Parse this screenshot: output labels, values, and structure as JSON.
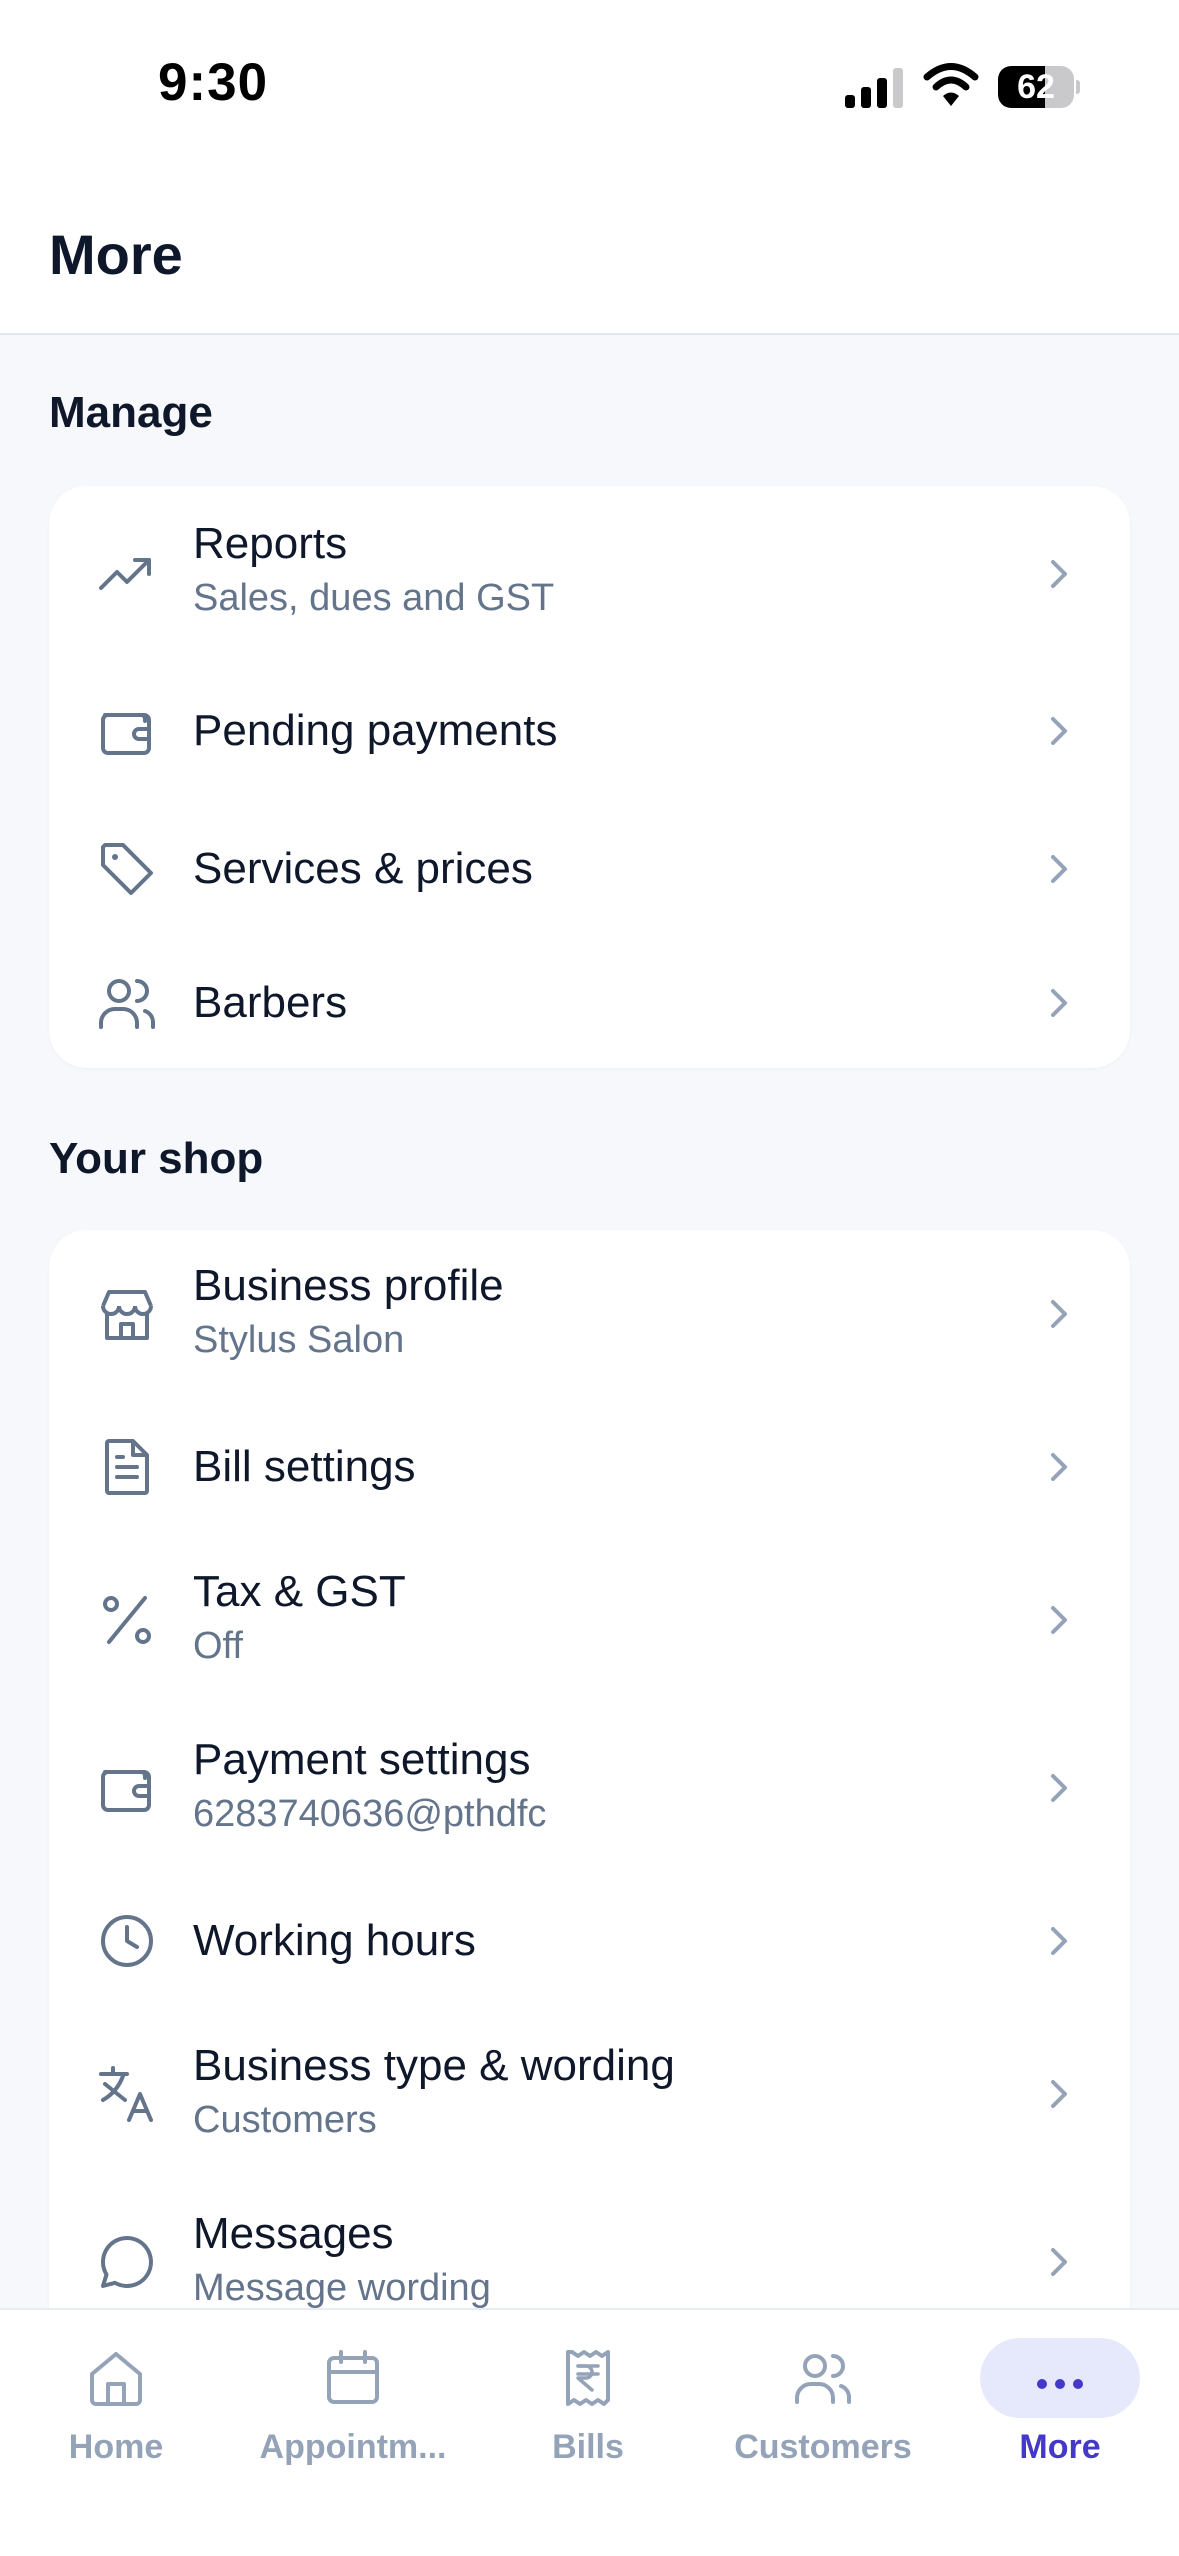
{
  "status_bar": {
    "time": "9:30",
    "battery_level": "62"
  },
  "header": {
    "title": "More"
  },
  "manage": {
    "title": "Manage",
    "items": [
      {
        "label": "Reports",
        "sub": "Sales, dues and GST",
        "icon": "trending-up-icon"
      },
      {
        "label": "Pending payments",
        "sub": "",
        "icon": "wallet-icon"
      },
      {
        "label": "Services & prices",
        "sub": "",
        "icon": "tag-icon"
      },
      {
        "label": "Barbers",
        "sub": "",
        "icon": "users-icon"
      }
    ]
  },
  "shop": {
    "title": "Your shop",
    "items": [
      {
        "label": "Business profile",
        "sub": "Stylus Salon",
        "icon": "store-icon"
      },
      {
        "label": "Bill settings",
        "sub": "",
        "icon": "document-icon"
      },
      {
        "label": "Tax & GST",
        "sub": "Off",
        "icon": "percent-icon"
      },
      {
        "label": "Payment settings",
        "sub": "6283740636@pthdfc",
        "icon": "wallet-icon"
      },
      {
        "label": "Working hours",
        "sub": "",
        "icon": "clock-icon"
      },
      {
        "label": "Business type & wording",
        "sub": "Customers",
        "icon": "translate-icon"
      },
      {
        "label": "Messages",
        "sub": "Message wording",
        "icon": "chat-icon"
      }
    ]
  },
  "tabs": [
    {
      "label": "Home",
      "icon": "home-icon",
      "active": false
    },
    {
      "label": "Appointm...",
      "icon": "calendar-icon",
      "active": false
    },
    {
      "label": "Bills",
      "icon": "receipt-icon",
      "active": false
    },
    {
      "label": "Customers",
      "icon": "users-icon",
      "active": false
    },
    {
      "label": "More",
      "icon": "more-dots-icon",
      "active": true
    }
  ],
  "colors": {
    "accent": "#4338ca",
    "muted": "#94a3b8",
    "icon": "#64748b",
    "background": "#f6f8fb"
  }
}
